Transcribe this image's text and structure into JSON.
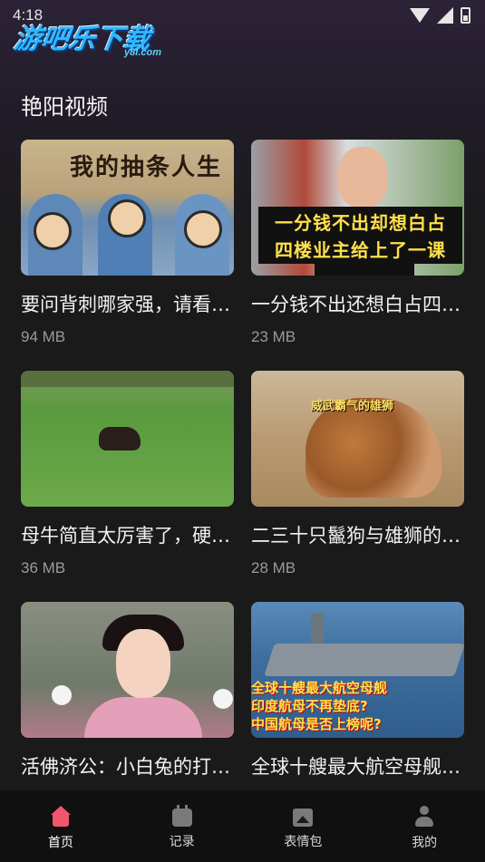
{
  "status_bar": {
    "time": "4:18"
  },
  "brand": {
    "logo_text": "游吧乐下载",
    "logo_sub": "y8l.com"
  },
  "section": {
    "title": "艳阳视频"
  },
  "videos": [
    {
      "title": "要问背刺哪家强，请看V…",
      "size": "94 MB",
      "thumb_caption": "我的抽条人生"
    },
    {
      "title": "一分钱不出还想白占四…",
      "size": "23 MB",
      "thumb_caption_1": "一分钱不出却想白占",
      "thumb_caption_2": "四楼业主给上了一课"
    },
    {
      "title": "母牛简直太厉害了，硬…",
      "size": "36 MB"
    },
    {
      "title": "二三十只鬣狗与雄狮的…",
      "size": "28 MB",
      "thumb_caption": "威武霸气的雄狮"
    },
    {
      "title": "活佛济公：小白兔的打…",
      "size": ""
    },
    {
      "title": "全球十艘最大航空母舰…",
      "size": "",
      "thumb_caption_1": "全球十艘最大航空母舰",
      "thumb_caption_2": "印度航母不再垫底?",
      "thumb_caption_3": "中国航母是否上榜呢?"
    }
  ],
  "bottom_nav": [
    {
      "label": "首页",
      "icon": "home-icon",
      "active": true
    },
    {
      "label": "记录",
      "icon": "record-icon",
      "active": false
    },
    {
      "label": "表情包",
      "icon": "image-icon",
      "active": false
    },
    {
      "label": "我的",
      "icon": "user-icon",
      "active": false
    }
  ],
  "colors": {
    "accent": "#f0566e",
    "background": "#1a1a1a",
    "nav_bg": "#101010",
    "muted_text": "#9a9a9a"
  }
}
